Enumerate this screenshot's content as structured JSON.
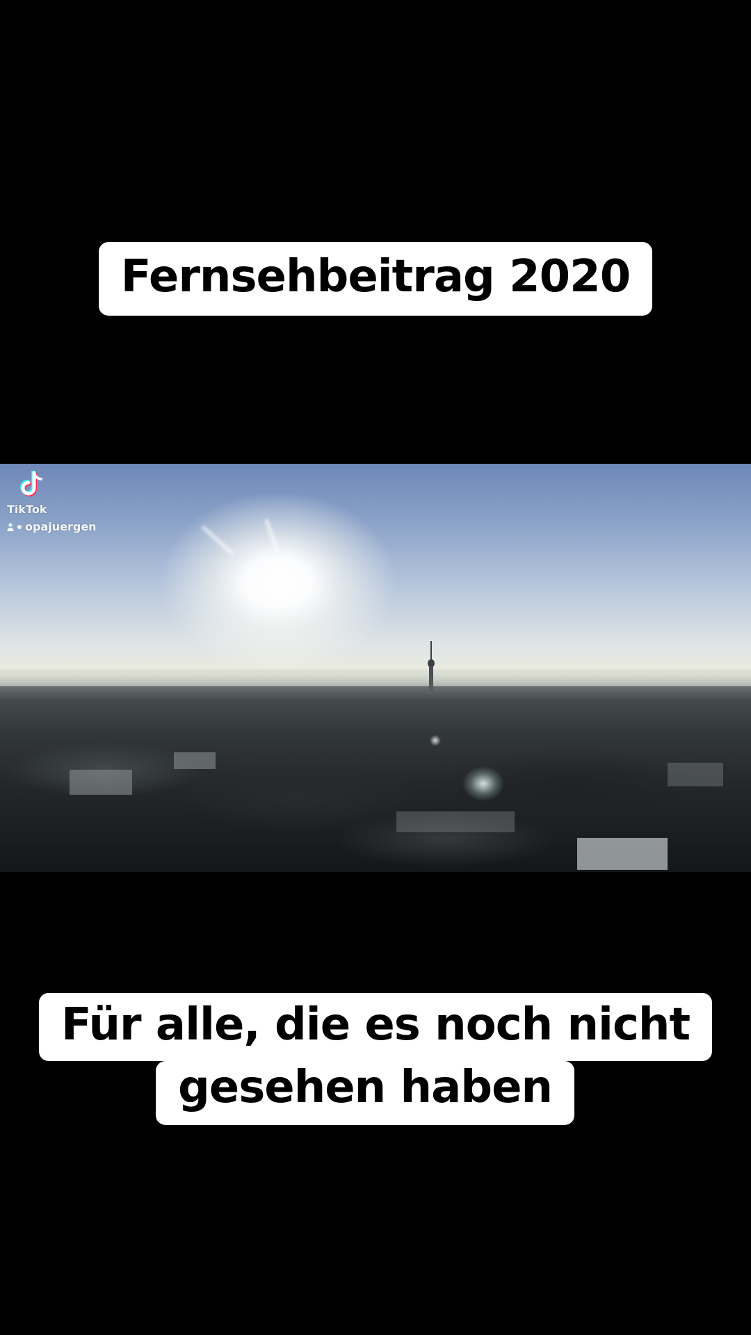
{
  "caption_top": {
    "text": "Fernsehbeitrag 2020"
  },
  "caption_bottom": {
    "line1": "Für alle, die es noch nicht",
    "line2": "gesehen haben"
  },
  "video": {
    "watermark": {
      "brand": "TikTok",
      "handle": "opajuergen",
      "logo_icon": "tiktok-logo-icon",
      "user_icon": "user-icon"
    }
  },
  "colors": {
    "background": "#000000",
    "caption_bg": "#ffffff",
    "caption_text": "#000000",
    "watermark_text": "#ffffff"
  }
}
